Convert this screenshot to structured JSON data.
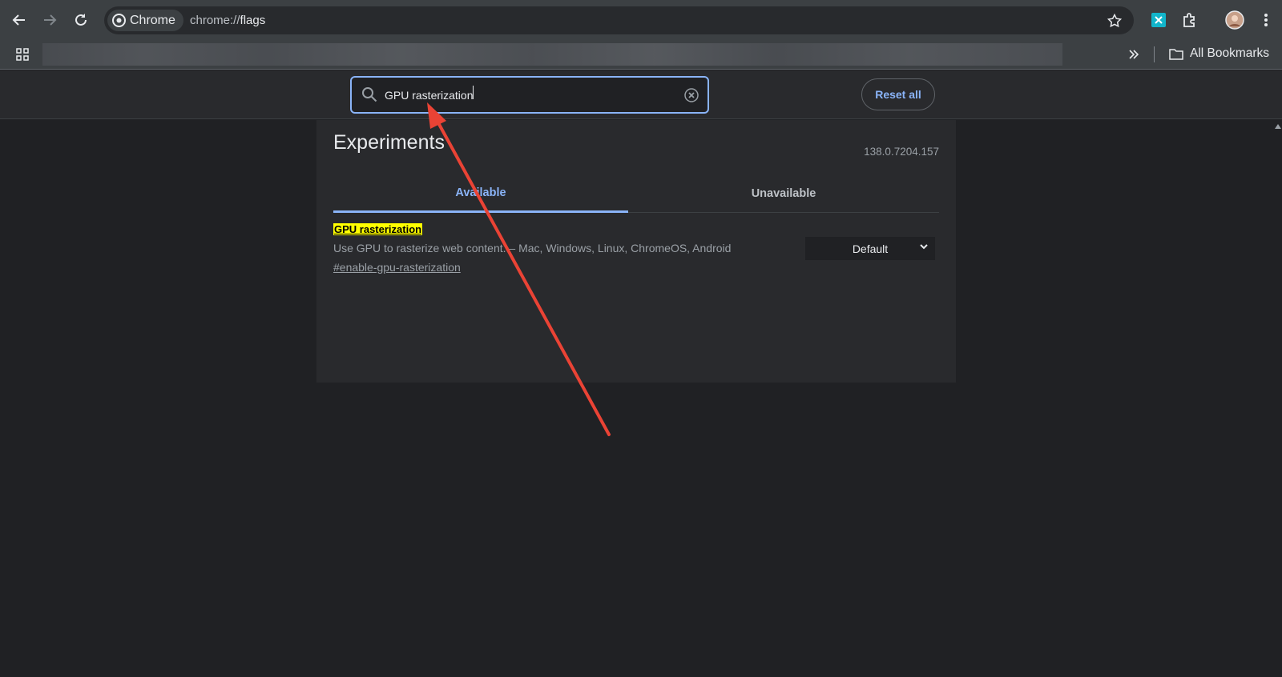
{
  "browser": {
    "chip_label": "Chrome",
    "url_prefix": "chrome://",
    "url_host": "flags",
    "all_bookmarks_label": "All Bookmarks",
    "icons": [
      "back-icon",
      "forward-icon",
      "reload-icon",
      "chrome-logo-icon",
      "star-icon",
      "extension-icon",
      "puzzle-icon",
      "profile-avatar",
      "menu-icon",
      "apps-icon",
      "chevron-double-right-icon",
      "folder-icon"
    ]
  },
  "header": {
    "search_value": "GPU rasterization",
    "reset_label": "Reset all"
  },
  "main": {
    "title": "Experiments",
    "version": "138.0.7204.157",
    "tabs": [
      {
        "label": "Available",
        "selected": true
      },
      {
        "label": "Unavailable",
        "selected": false
      }
    ],
    "flag": {
      "name": "GPU rasterization",
      "description": "Use GPU to rasterize web content. – Mac, Windows, Linux, ChromeOS, Android",
      "link": "#enable-gpu-rasterization",
      "selected_option": "Default"
    }
  },
  "colors": {
    "accent": "#8ab4f8",
    "highlight": "#ffff00",
    "annotation_arrow": "#ea4335",
    "background": "#202124"
  }
}
